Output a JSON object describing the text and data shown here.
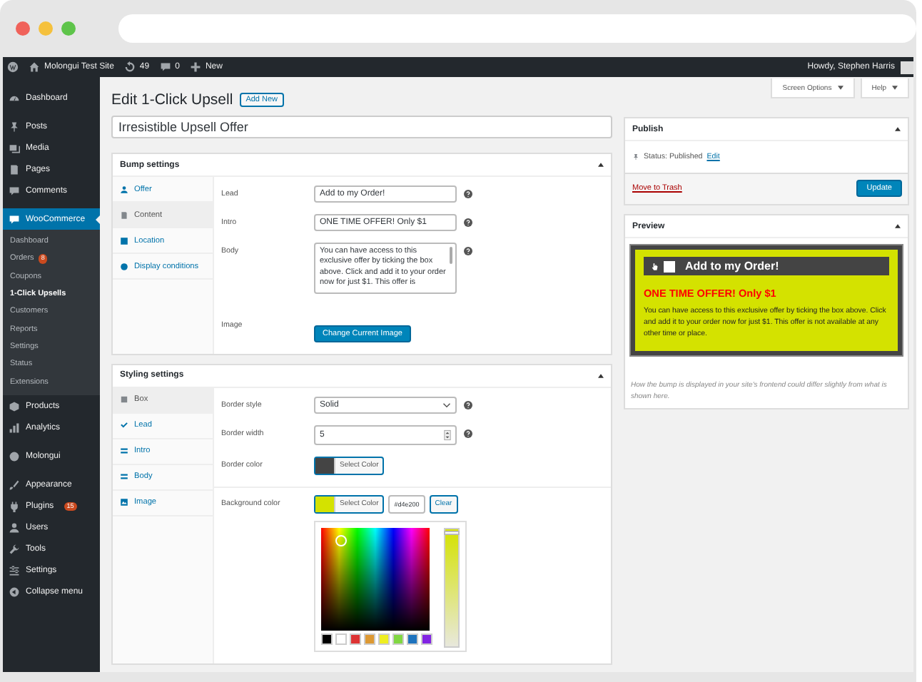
{
  "admin_bar": {
    "site_name": "Molongui Test Site",
    "updates": "49",
    "comments": "0",
    "new_label": "New",
    "greeting": "Howdy, Stephen Harris"
  },
  "sidebar": {
    "items": [
      {
        "label": "Dashboard",
        "selected": false
      },
      {
        "label": "Posts",
        "selected": false
      },
      {
        "label": "Media",
        "selected": false
      },
      {
        "label": "Pages",
        "selected": false
      },
      {
        "label": "Comments",
        "selected": false
      },
      {
        "label": "WooCommerce",
        "selected": true,
        "children": [
          {
            "label": "Dashboard",
            "selected": false
          },
          {
            "label": "Orders",
            "badge": "8",
            "selected": false
          },
          {
            "label": "Coupons",
            "selected": false
          },
          {
            "label": "1-Click Upsells",
            "selected": true
          },
          {
            "label": "Customers",
            "selected": false
          },
          {
            "label": "Reports",
            "selected": false
          },
          {
            "label": "Settings",
            "selected": false
          },
          {
            "label": "Status",
            "selected": false
          },
          {
            "label": "Extensions",
            "selected": false
          }
        ]
      },
      {
        "label": "Products",
        "selected": false
      },
      {
        "label": "Analytics",
        "selected": false
      },
      {
        "label": "Molongui",
        "selected": false
      },
      {
        "label": "Appearance",
        "selected": false
      },
      {
        "label": "Plugins",
        "badge": "15",
        "selected": false
      },
      {
        "label": "Users",
        "selected": false
      },
      {
        "label": "Tools",
        "selected": false
      },
      {
        "label": "Settings",
        "selected": false
      },
      {
        "label": "Collapse menu",
        "selected": false
      }
    ]
  },
  "header": {
    "screen_options": "Screen Options",
    "help": "Help",
    "title": "Edit 1-Click Upsell",
    "add_new": "Add New",
    "post_title": "Irresistible Upsell Offer"
  },
  "bump_settings": {
    "title": "Bump settings",
    "tabs": [
      {
        "label": "Offer",
        "selected": false
      },
      {
        "label": "Content",
        "selected": true
      },
      {
        "label": "Location",
        "selected": false
      },
      {
        "label": "Display conditions",
        "selected": false
      }
    ],
    "sections": [
      {
        "fields": [
          {
            "kind": "text",
            "label": "Lead",
            "value": "Add to my Order!",
            "help": true
          },
          {
            "kind": "text",
            "label": "Intro",
            "value": "ONE TIME OFFER! Only $1",
            "help": true
          },
          {
            "kind": "textarea",
            "label": "Body",
            "value": "You can have access to this exclusive offer by ticking the box above. Click and add it to your order now for just $1. This offer is",
            "help": true
          },
          {
            "kind": "button",
            "label": "Image",
            "button": "Change Current Image",
            "help": false
          }
        ]
      }
    ]
  },
  "styling_settings": {
    "title": "Styling settings",
    "tabs": [
      {
        "label": "Box",
        "selected": true
      },
      {
        "label": "Lead",
        "selected": false
      },
      {
        "label": "Intro",
        "selected": false
      },
      {
        "label": "Body",
        "selected": false
      },
      {
        "label": "Image",
        "selected": false
      }
    ],
    "sections": [
      {
        "fields": [
          {
            "kind": "select",
            "label": "Border style",
            "value": "Solid",
            "help": true
          },
          {
            "kind": "number",
            "label": "Border width",
            "value": "5",
            "help": true
          },
          {
            "kind": "color",
            "label": "Border color",
            "color": "#444444",
            "button": "Select Color",
            "help": false,
            "picker_open": false
          }
        ]
      },
      {
        "fields": [
          {
            "kind": "color",
            "label": "Background color",
            "color": "#d4e200",
            "button": "Select Color",
            "value": "#d4e200",
            "clear": "Clear",
            "help": false,
            "picker_open": true
          }
        ]
      }
    ],
    "palette": [
      {
        "color": "#000000"
      },
      {
        "color": "#ffffff"
      },
      {
        "color": "#dd3333"
      },
      {
        "color": "#dd9933"
      },
      {
        "color": "#eeee22"
      },
      {
        "color": "#81d742"
      },
      {
        "color": "#1e73be"
      },
      {
        "color": "#8224e3"
      }
    ]
  },
  "publish": {
    "title": "Publish",
    "status": "Status: Published",
    "edit_link": "Edit",
    "trash_link": "Move to Trash",
    "update": "Update"
  },
  "preview": {
    "title": "Preview",
    "checked": false,
    "lead": "Add to my Order!",
    "intro": "ONE TIME OFFER! Only $1",
    "body": "You can have access to this exclusive offer by ticking the box above. Click and add it to your order now for just $1. This offer is not available at any other time or place.",
    "note": "How the bump is displayed in your site's frontend could differ slightly from what is shown here."
  }
}
